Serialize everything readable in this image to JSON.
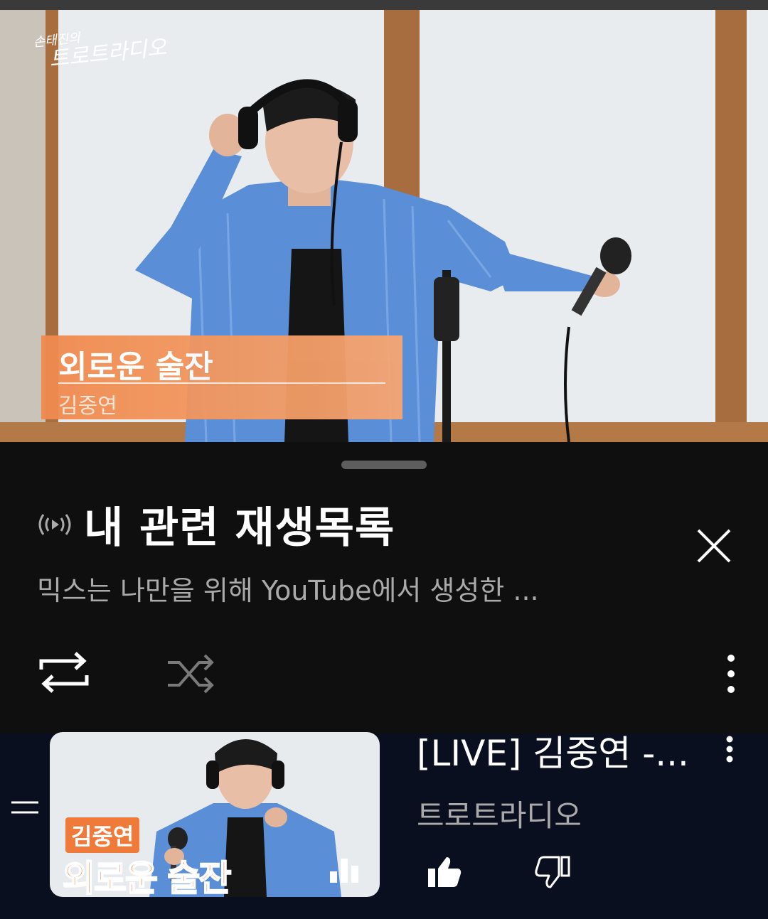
{
  "video": {
    "studio_logo_line1": "손태진의",
    "studio_logo_line2": "트로트라디오",
    "lower_third_song": "외로운 술잔",
    "lower_third_artist": "김중연"
  },
  "sheet": {
    "title": "내 관련 재생목록",
    "subtitle": "믹스는 나만을 위해 YouTube에서 생성한 ...",
    "icons": {
      "mix": "mix-radio-icon",
      "close": "close-icon",
      "repeat": "repeat-icon",
      "shuffle": "shuffle-icon",
      "more": "more-vert-icon"
    }
  },
  "playlist_item": {
    "thumbnail_label_artist": "김중연",
    "thumbnail_label_song": "외로운 술잔",
    "title": "[LIVE] 김중연 -...",
    "channel": "트로트라디오",
    "icons": {
      "drag": "drag-handle-icon",
      "now_playing": "equalizer-icon",
      "more": "more-vert-icon",
      "like": "thumb-up-icon",
      "dislike": "thumb-down-icon"
    }
  },
  "colors": {
    "background": "#0f0f0f",
    "secondary_text": "#aaaaaa",
    "lower_third": "#f08a4e"
  }
}
